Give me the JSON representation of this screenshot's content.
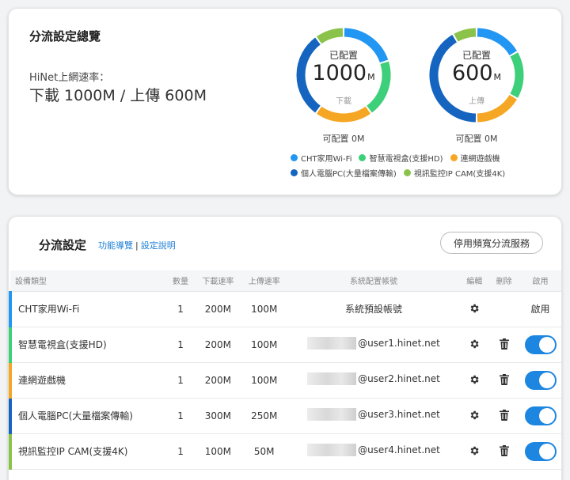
{
  "overview": {
    "title": "分流設定總覽",
    "rate_label": "HiNet上網速率：",
    "rate_value": "下載 1000M / 上傳 600M",
    "download": {
      "top_label": "已配置",
      "value": "1000",
      "unit": "M",
      "sub_label": "下載",
      "available": "可配置 0M"
    },
    "upload": {
      "top_label": "已配置",
      "value": "600",
      "unit": "M",
      "sub_label": "上傳",
      "available": "可配置 0M"
    },
    "legend": [
      {
        "label": "CHT家用Wi-Fi",
        "color": "#2196f3"
      },
      {
        "label": "智慧電視盒(支援HD)",
        "color": "#3ecf7a"
      },
      {
        "label": "連網遊戲機",
        "color": "#f5a623"
      },
      {
        "label": "個人電腦PC(大量檔案傳輸)",
        "color": "#1565c0"
      },
      {
        "label": "視訊監控IP CAM(支援4K)",
        "color": "#8bc34a"
      }
    ]
  },
  "settings": {
    "title": "分流設定",
    "link_guide": "功能導覽",
    "link_sep": "|",
    "link_help": "設定說明",
    "stop_button": "停用頻寬分流服務",
    "headers": [
      "設備類型",
      "數量",
      "下載速率",
      "上傳速率",
      "系統配置帳號",
      "編輯",
      "刪除",
      "啟用"
    ],
    "rows": [
      {
        "type": "CHT家用Wi-Fi",
        "color": "#2196f3",
        "qty": "1",
        "down": "200M",
        "up": "100M",
        "account": "系統預設帳號",
        "masked": false,
        "deletable": false,
        "enabled_text": "啟用",
        "toggle": false
      },
      {
        "type": "智慧電視盒(支援HD)",
        "color": "#3ecf7a",
        "qty": "1",
        "down": "200M",
        "up": "100M",
        "account": "@user1.hinet.net",
        "masked": true,
        "deletable": true,
        "enabled_text": "",
        "toggle": true
      },
      {
        "type": "連網遊戲機",
        "color": "#f5a623",
        "qty": "1",
        "down": "200M",
        "up": "100M",
        "account": "@user2.hinet.net",
        "masked": true,
        "deletable": true,
        "enabled_text": "",
        "toggle": true
      },
      {
        "type": "個人電腦PC(大量檔案傳輸)",
        "color": "#1565c0",
        "qty": "1",
        "down": "300M",
        "up": "250M",
        "account": "@user3.hinet.net",
        "masked": true,
        "deletable": true,
        "enabled_text": "",
        "toggle": true
      },
      {
        "type": "視訊監控IP CAM(支援4K)",
        "color": "#8bc34a",
        "qty": "1",
        "down": "100M",
        "up": "50M",
        "account": "@user4.hinet.net",
        "masked": true,
        "deletable": true,
        "enabled_text": "",
        "toggle": true
      }
    ]
  },
  "chart_data": [
    {
      "type": "pie",
      "title": "已配置 1000M",
      "categories": [
        "CHT家用Wi-Fi",
        "智慧電視盒(支援HD)",
        "連網遊戲機",
        "個人電腦PC(大量檔案傳輸)",
        "視訊監控IP CAM(支援4K)"
      ],
      "values": [
        200,
        200,
        200,
        300,
        100
      ],
      "colors": [
        "#2196f3",
        "#3ecf7a",
        "#f5a623",
        "#1565c0",
        "#8bc34a"
      ]
    },
    {
      "type": "pie",
      "title": "已配置 600M",
      "categories": [
        "CHT家用Wi-Fi",
        "智慧電視盒(支援HD)",
        "連網遊戲機",
        "個人電腦PC(大量檔案傳輸)",
        "視訊監控IP CAM(支援4K)"
      ],
      "values": [
        100,
        100,
        100,
        250,
        50
      ],
      "colors": [
        "#2196f3",
        "#3ecf7a",
        "#f5a623",
        "#1565c0",
        "#8bc34a"
      ]
    }
  ]
}
